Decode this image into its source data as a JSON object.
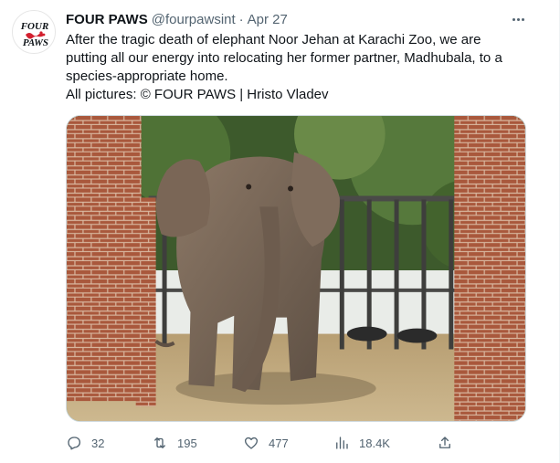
{
  "tweet": {
    "author_name": "FOUR PAWS",
    "handle": "@fourpawsint",
    "separator": "·",
    "date": "Apr 27",
    "text_lines": [
      "After the tragic death of elephant Noor Jehan at Karachi Zoo, we are",
      "putting all our energy into relocating her former partner, Madhubala, to a",
      "species-appropriate home.",
      "All pictures: © FOUR PAWS | Hristo Vladev"
    ],
    "avatar_logo_text": [
      "FOUR",
      "PAWS"
    ],
    "media_icon": "elephant-photo"
  },
  "actions": {
    "reply_count": "32",
    "retweet_count": "195",
    "like_count": "477",
    "views_count": "18.4K",
    "icons": [
      "reply-icon",
      "retweet-icon",
      "like-icon",
      "views-icon",
      "share-icon"
    ]
  },
  "colors": {
    "text": "#0f1419",
    "secondary": "#536471",
    "border": "#cfd9de",
    "brand_red": "#d3202f"
  }
}
